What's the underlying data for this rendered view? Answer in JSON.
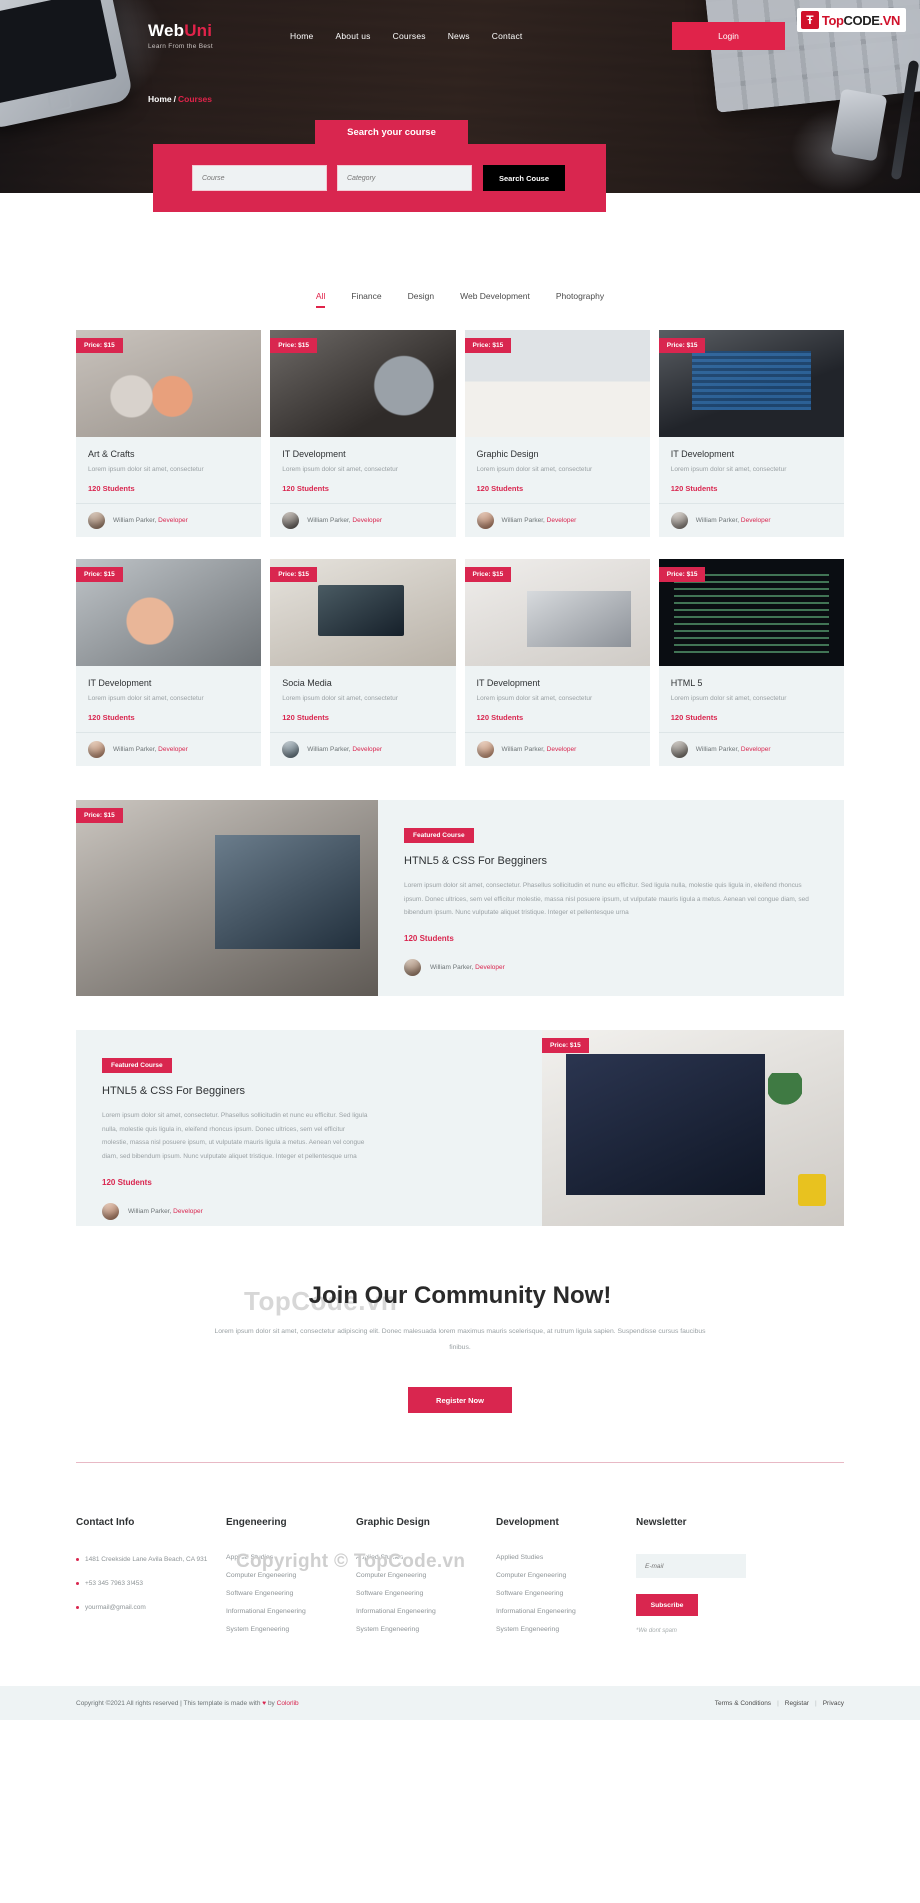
{
  "brand": {
    "name_1": "Web",
    "name_2": "Uni",
    "tagline": "Learn From the Best"
  },
  "nav": {
    "items": [
      "Home",
      "About us",
      "Courses",
      "News",
      "Contact"
    ],
    "login_label": "Login"
  },
  "topcode_logo": {
    "mark": "Ŧ",
    "t1": "Top",
    "t2": "CODE",
    "t3": ".VN"
  },
  "breadcrumb": {
    "home": "Home",
    "separator": "/",
    "current": "Courses"
  },
  "search": {
    "title": "Search your course",
    "course_placeholder": "Course",
    "category_placeholder": "Category",
    "submit_label": "Search Couse"
  },
  "tabs": [
    {
      "label": "All",
      "active": true
    },
    {
      "label": "Finance",
      "active": false
    },
    {
      "label": "Design",
      "active": false
    },
    {
      "label": "Web Development",
      "active": false
    },
    {
      "label": "Photography",
      "active": false
    }
  ],
  "courses": [
    {
      "price": "Price: $15",
      "title": "Art & Crafts",
      "desc": "Lorem ipsum dolor sit amet, consectetur",
      "students": "120 Students",
      "author": "William Parker,",
      "role": "Developer"
    },
    {
      "price": "Price: $15",
      "title": "IT Development",
      "desc": "Lorem ipsum dolor sit amet, consectetur",
      "students": "120 Students",
      "author": "William Parker,",
      "role": "Developer"
    },
    {
      "price": "Price: $15",
      "title": "Graphic Design",
      "desc": "Lorem ipsum dolor sit amet, consectetur",
      "students": "120 Students",
      "author": "William Parker,",
      "role": "Developer"
    },
    {
      "price": "Price: $15",
      "title": "IT Development",
      "desc": "Lorem ipsum dolor sit amet, consectetur",
      "students": "120 Students",
      "author": "William Parker,",
      "role": "Developer"
    },
    {
      "price": "Price: $15",
      "title": "IT Development",
      "desc": "Lorem ipsum dolor sit amet, consectetur",
      "students": "120 Students",
      "author": "William Parker,",
      "role": "Developer"
    },
    {
      "price": "Price: $15",
      "title": "Socia Media",
      "desc": "Lorem ipsum dolor sit amet, consectetur",
      "students": "120 Students",
      "author": "William Parker,",
      "role": "Developer"
    },
    {
      "price": "Price: $15",
      "title": "IT Development",
      "desc": "Lorem ipsum dolor sit amet, consectetur",
      "students": "120 Students",
      "author": "William Parker,",
      "role": "Developer"
    },
    {
      "price": "Price: $15",
      "title": "HTML 5",
      "desc": "Lorem ipsum dolor sit amet, consectetur",
      "students": "120 Students",
      "author": "William Parker,",
      "role": "Developer"
    }
  ],
  "featured_left": {
    "price": "Price: $15",
    "badge": "Featured Course",
    "title": "HTNL5 & CSS For Begginers",
    "desc": "Lorem ipsum dolor sit amet, consectetur. Phasellus sollicitudin et nunc eu efficitur. Sed ligula nulla, molestie quis ligula in, eleifend rhoncus ipsum. Donec ultrices, sem vel efficitur molestie, massa nisl posuere ipsum, ut vulputate mauris ligula a metus. Aenean vel congue diam, sed bibendum ipsum. Nunc vulputate aliquet tristique. Integer et pellentesque urna",
    "students": "120 Students",
    "author": "William Parker,",
    "role": "Developer"
  },
  "featured_right": {
    "price": "Price: $15",
    "badge": "Featured Course",
    "title": "HTNL5 & CSS For Begginers",
    "desc": "Lorem ipsum dolor sit amet, consectetur. Phasellus sollicitudin et nunc eu efficitur. Sed ligula nulla, molestie quis ligula in, eleifend rhoncus ipsum. Donec ultrices, sem vel efficitur molestie, massa nisl posuere ipsum, ut vulputate mauris ligula a metus. Aenean vel congue diam, sed bibendum ipsum. Nunc vulputate aliquet tristique. Integer et pellentesque urna",
    "students": "120 Students",
    "author": "William Parker,",
    "role": "Developer"
  },
  "join": {
    "watermark": "TopCode.vn",
    "title": "Join Our Community Now!",
    "desc": "Lorem ipsum dolor sit amet, consectetur adipiscing elit. Donec malesuada lorem maximus mauris scelerisque, at rutrum ligula sapien. Suspendisse cursus faucibus finibus.",
    "button": "Register Now"
  },
  "footer": {
    "watermark": "Copyright © TopCode.vn",
    "contact": {
      "heading": "Contact Info",
      "items": [
        "1481 Creekside Lane Avila Beach, CA 931",
        "+53 345 7963 3!453",
        "yourmail@gmail.com"
      ]
    },
    "columns": [
      {
        "heading": "Engeneering",
        "links": [
          "Applied Studies",
          "Computer Engeneering",
          "Software Engeneering",
          "Informational Engeneering",
          "System Engeneering"
        ]
      },
      {
        "heading": "Graphic Design",
        "links": [
          "Applied Studies",
          "Computer Engeneering",
          "Software Engeneering",
          "Informational Engeneering",
          "System Engeneering"
        ]
      },
      {
        "heading": "Development",
        "links": [
          "Applied Studies",
          "Computer Engeneering",
          "Software Engeneering",
          "Informational Engeneering",
          "System Engeneering"
        ]
      }
    ],
    "newsletter": {
      "heading": "Newsletter",
      "placeholder": "E-mail",
      "button": "Subscribe",
      "note": "*We dont spam"
    },
    "bottom": {
      "copyright_pre": "Copyright ©2021 All rights reserved | This template is made with ",
      "heart": "♥",
      "copyright_mid": " by ",
      "colorlib": "Colorlib",
      "links": [
        "Terms & Conditions",
        "|",
        "Registar",
        "|",
        "Privacy"
      ]
    }
  },
  "colors": {
    "accent": "#d9264f",
    "accent_dark": "#e0234a",
    "card_bg": "#eef3f4",
    "dark": "#2a211f"
  }
}
